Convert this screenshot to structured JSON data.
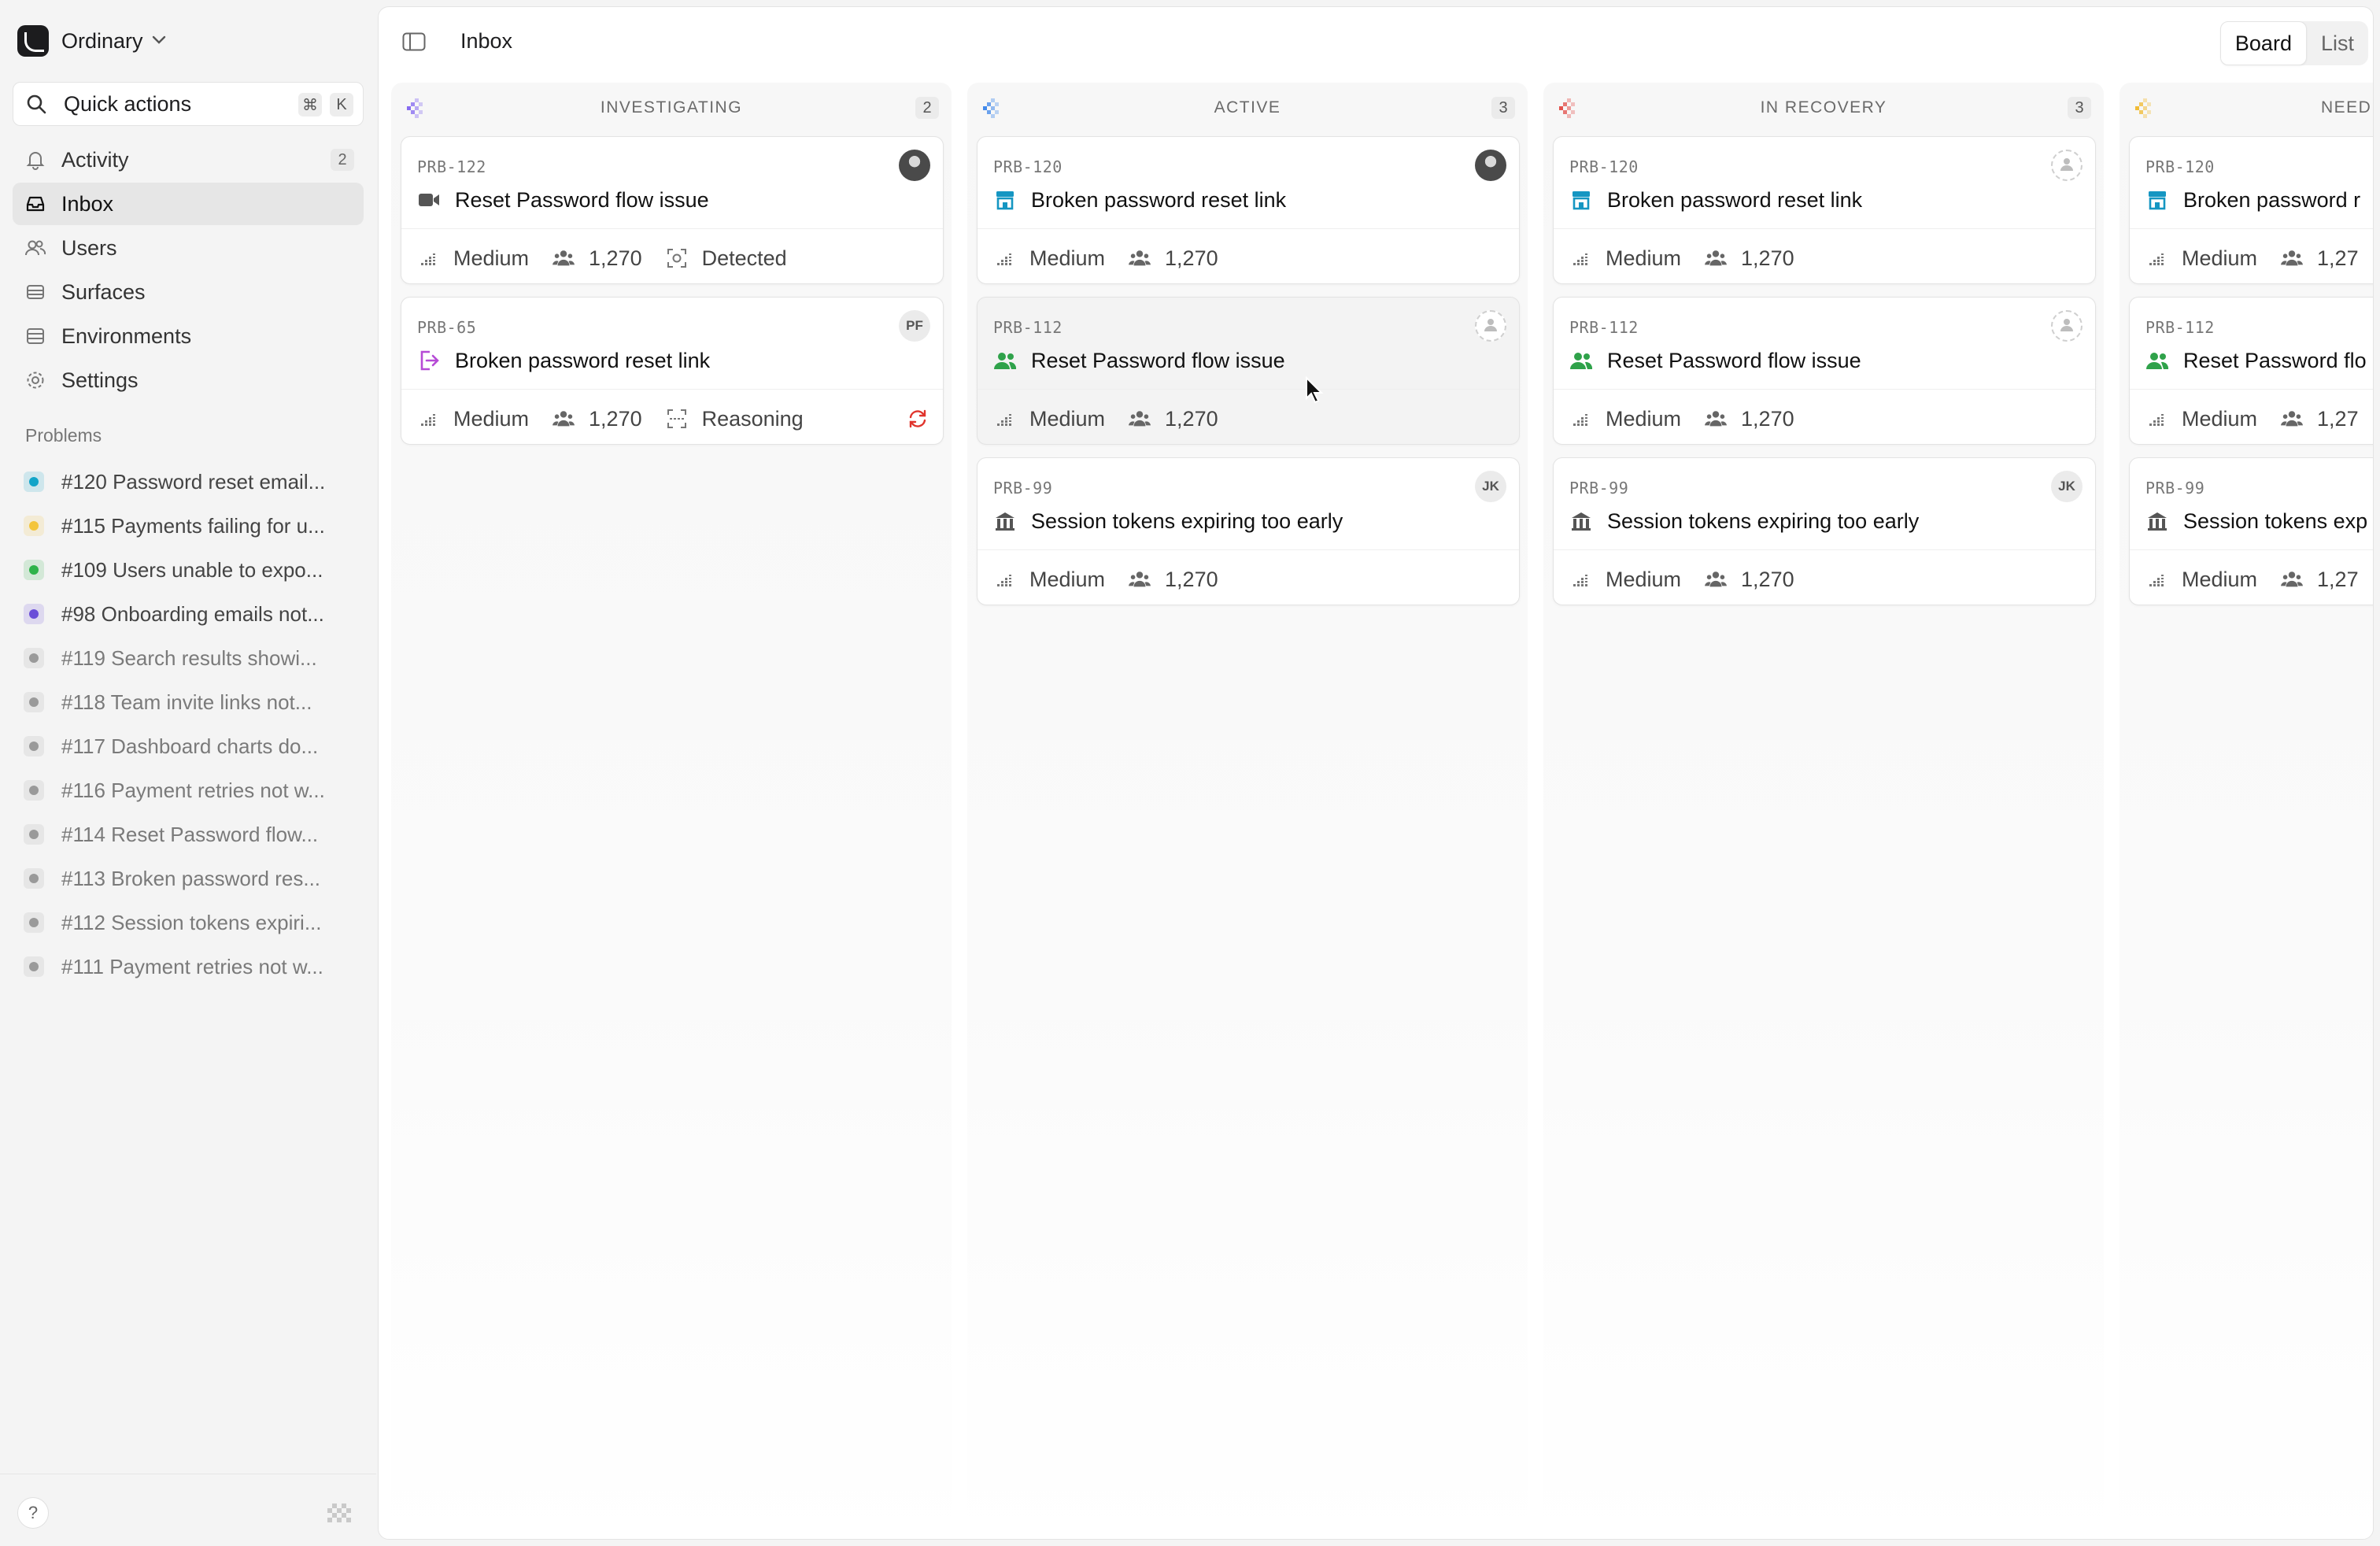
{
  "workspace": {
    "name": "Ordinary"
  },
  "quick_actions": {
    "label": "Quick actions",
    "shortcut_cmd": "⌘",
    "shortcut_key": "K"
  },
  "nav": [
    {
      "label": "Activity",
      "badge": "2",
      "icon": "bell-icon"
    },
    {
      "label": "Inbox",
      "active": true,
      "icon": "inbox-icon"
    },
    {
      "label": "Users",
      "icon": "users-icon"
    },
    {
      "label": "Surfaces",
      "icon": "layers-icon"
    },
    {
      "label": "Environments",
      "icon": "database-icon"
    },
    {
      "label": "Settings",
      "icon": "gear-icon"
    }
  ],
  "problems": {
    "title": "Problems",
    "items": [
      {
        "label": "#120 Password reset email...",
        "color": "#12a4c8"
      },
      {
        "label": "#115 Payments failing for u...",
        "color": "#f3c53c"
      },
      {
        "label": "#109 Users unable to expo...",
        "color": "#2fb34a"
      },
      {
        "label": "#98 Onboarding emails not...",
        "color": "#6b4fd8"
      },
      {
        "label": "#119 Search results showi...",
        "color": "#9a9a9a"
      },
      {
        "label": "#118 Team invite links not...",
        "color": "#9a9a9a"
      },
      {
        "label": "#117 Dashboard charts do...",
        "color": "#9a9a9a"
      },
      {
        "label": "#116 Payment retries not w...",
        "color": "#9a9a9a"
      },
      {
        "label": "#114 Reset Password flow...",
        "color": "#9a9a9a"
      },
      {
        "label": "#113 Broken password res...",
        "color": "#9a9a9a"
      },
      {
        "label": "#112 Session tokens expiri...",
        "color": "#9a9a9a"
      },
      {
        "label": "#111 Payment retries not w...",
        "color": "#9a9a9a"
      }
    ]
  },
  "footer": {
    "help": "?"
  },
  "header": {
    "title": "Inbox",
    "view_board": "Board",
    "view_list": "List"
  },
  "columns": [
    {
      "title": "INVESTIGATING",
      "count": "2",
      "color": "#7a5cf0",
      "cards": [
        {
          "id": "PRB-122",
          "title": "Reset Password flow issue",
          "type": "video-icon",
          "type_color": "#555555",
          "severity": "Medium",
          "users": "1,270",
          "status": "Detected",
          "avatar": "photo"
        },
        {
          "id": "PRB-65",
          "title": "Broken password reset link",
          "type": "exit-icon",
          "type_color": "#b64bd6",
          "severity": "Medium",
          "users": "1,270",
          "status": "Reasoning",
          "avatar": "initials",
          "initials": "PF",
          "corner": "refresh-icon"
        }
      ]
    },
    {
      "title": "ACTIVE",
      "count": "3",
      "color": "#2f7de8",
      "cards": [
        {
          "id": "PRB-120",
          "title": "Broken password reset link",
          "type": "store-icon",
          "type_color": "#1596c2",
          "severity": "Medium",
          "users": "1,270",
          "avatar": "photo"
        },
        {
          "id": "PRB-112",
          "title": "Reset Password flow issue",
          "type": "users-icon",
          "type_color": "#2fa24a",
          "severity": "Medium",
          "users": "1,270",
          "avatar": "empty",
          "hover": true
        },
        {
          "id": "PRB-99",
          "title": "Session tokens expiring too early",
          "type": "bank-icon",
          "type_color": "#555555",
          "severity": "Medium",
          "users": "1,270",
          "avatar": "initials",
          "initials": "JK"
        }
      ]
    },
    {
      "title": "IN RECOVERY",
      "count": "3",
      "color": "#e0403a",
      "cards": [
        {
          "id": "PRB-120",
          "title": "Broken password reset link",
          "type": "store-icon",
          "type_color": "#1596c2",
          "severity": "Medium",
          "users": "1,270",
          "avatar": "empty"
        },
        {
          "id": "PRB-112",
          "title": "Reset Password flow issue",
          "type": "users-icon",
          "type_color": "#2fa24a",
          "severity": "Medium",
          "users": "1,270",
          "avatar": "empty"
        },
        {
          "id": "PRB-99",
          "title": "Session tokens expiring too early",
          "type": "bank-icon",
          "type_color": "#555555",
          "severity": "Medium",
          "users": "1,270",
          "avatar": "initials",
          "initials": "JK"
        }
      ]
    },
    {
      "title": "NEED",
      "count": "",
      "color": "#f0b521",
      "cards": [
        {
          "id": "PRB-120",
          "title": "Broken password r",
          "type": "store-icon",
          "type_color": "#1596c2",
          "severity": "Medium",
          "users": "1,27"
        },
        {
          "id": "PRB-112",
          "title": "Reset Password flo",
          "type": "users-icon",
          "type_color": "#2fa24a",
          "severity": "Medium",
          "users": "1,27"
        },
        {
          "id": "PRB-99",
          "title": "Session tokens exp",
          "type": "bank-icon",
          "type_color": "#555555",
          "severity": "Medium",
          "users": "1,27"
        }
      ]
    }
  ]
}
